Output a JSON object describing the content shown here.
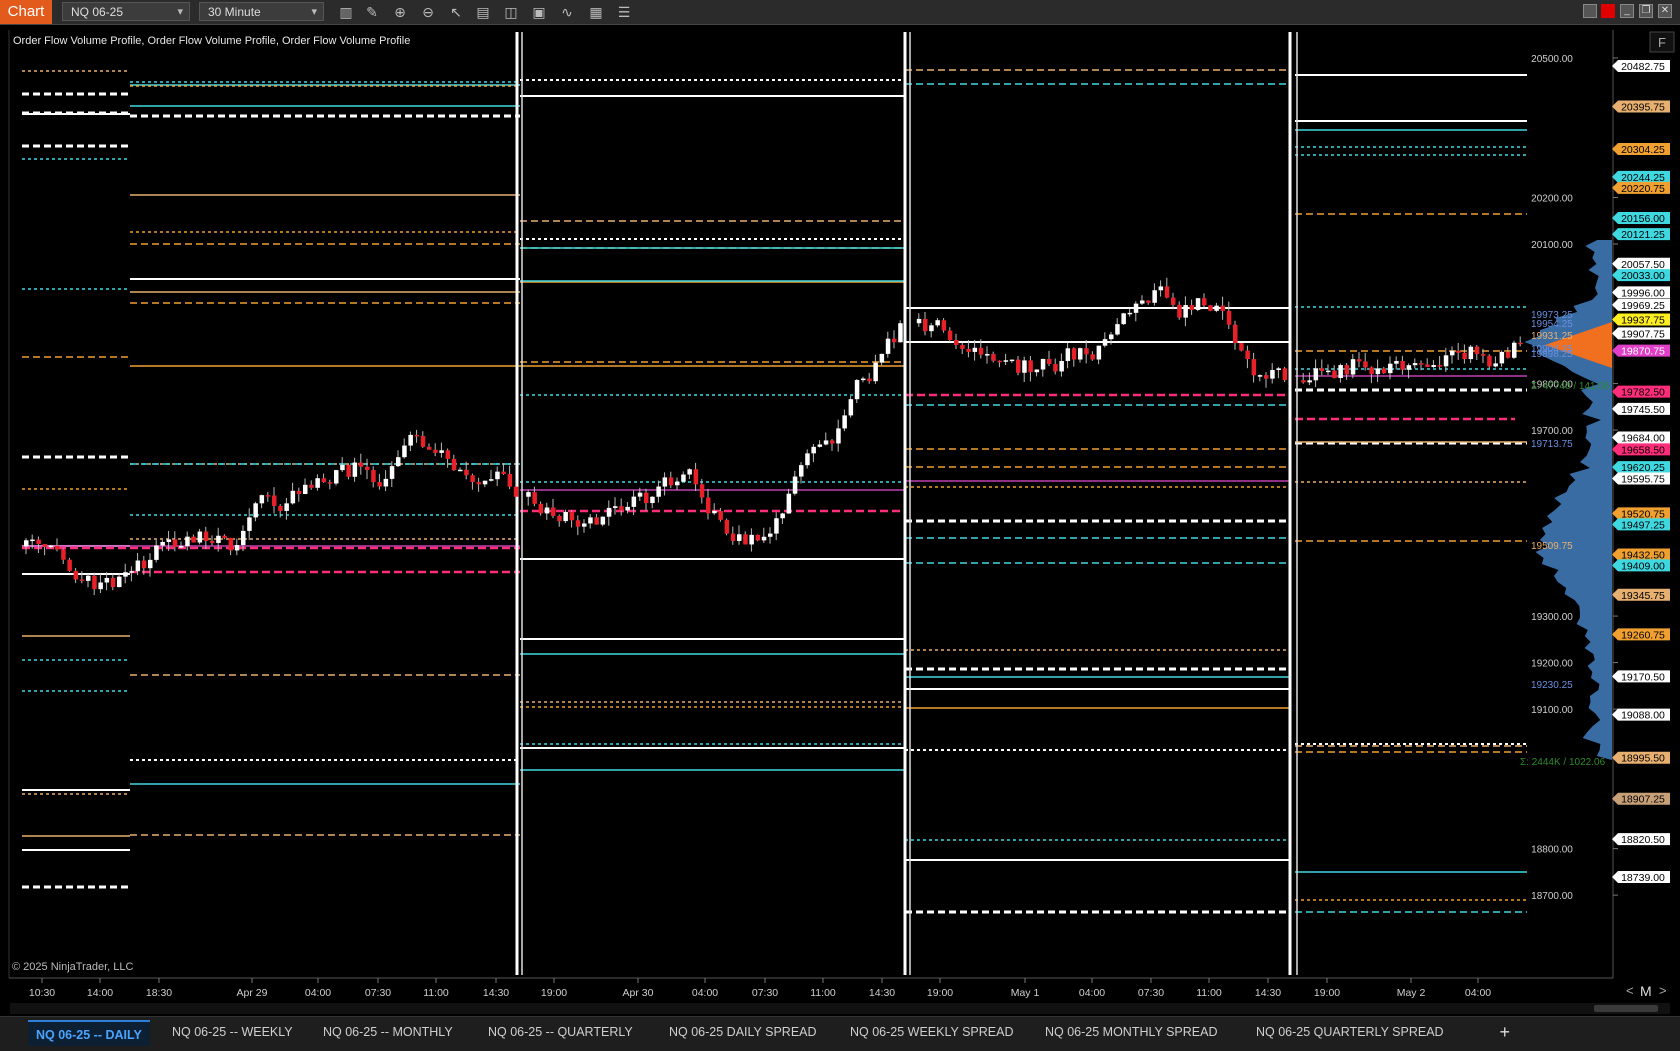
{
  "toolbar": {
    "chart_label": "Chart",
    "instrument": "NQ 06-25",
    "interval": "30 Minute",
    "tools": [
      "bar-style-icon",
      "draw-pencil-icon",
      "zoom-in-icon",
      "zoom-out-icon",
      "pointer-icon",
      "properties-icon",
      "split-panel-icon",
      "data-box-icon",
      "indicators-icon",
      "strategies-icon",
      "list-icon"
    ]
  },
  "chart": {
    "indicator_label": "Order Flow Volume Profile, Order Flow Volume Profile, Order Flow Volume Profile",
    "f_button": "F",
    "copyright": "© 2025 NinjaTrader, LLC",
    "y_axis_ticks": [
      "20500.00",
      "20200.00",
      "20100.00",
      "19800.00",
      "19700.00",
      "19300.00",
      "19200.00",
      "19100.00",
      "18800.00",
      "18700.00"
    ],
    "x_axis_labels": [
      "10:30",
      "14:00",
      "18:30",
      "Apr 29",
      "04:00",
      "07:30",
      "11:00",
      "14:30",
      "19:00",
      "Apr 30",
      "04:00",
      "07:30",
      "11:00",
      "14:30",
      "19:00",
      "May 1",
      "04:00",
      "07:30",
      "11:00",
      "14:30",
      "19:00",
      "May 2",
      "04:00"
    ],
    "price_markers": [
      {
        "text": "20482.75",
        "bg": "#ffffff",
        "fg": "#000000"
      },
      {
        "text": "20395.75",
        "bg": "#e8b070",
        "fg": "#000000"
      },
      {
        "text": "20304.25",
        "bg": "#f0a030",
        "fg": "#000000"
      },
      {
        "text": "20244.25",
        "bg": "#40d8e0",
        "fg": "#000000"
      },
      {
        "text": "20220.75",
        "bg": "#f0a030",
        "fg": "#000000"
      },
      {
        "text": "20156.00",
        "bg": "#40d8e0",
        "fg": "#000000"
      },
      {
        "text": "20121.25",
        "bg": "#40d8e0",
        "fg": "#000000"
      },
      {
        "text": "20057.50",
        "bg": "#ffffff",
        "fg": "#000000"
      },
      {
        "text": "20033.00",
        "bg": "#40d8e0",
        "fg": "#000000"
      },
      {
        "text": "19996.00",
        "bg": "#ffffff",
        "fg": "#000000"
      },
      {
        "text": "19969.25",
        "bg": "#ffffff",
        "fg": "#000000"
      },
      {
        "text": "19937.75",
        "bg": "#ffee22",
        "fg": "#000000"
      },
      {
        "text": "19907.75",
        "bg": "#ffffff",
        "fg": "#000000"
      },
      {
        "text": "19870.75",
        "bg": "#e040c8",
        "fg": "#ffffff"
      },
      {
        "text": "19782.50",
        "bg": "#ff2d7a",
        "fg": "#000000"
      },
      {
        "text": "19745.50",
        "bg": "#ffffff",
        "fg": "#000000"
      },
      {
        "text": "19684.00",
        "bg": "#ffffff",
        "fg": "#000000"
      },
      {
        "text": "19658.50",
        "bg": "#ff2d7a",
        "fg": "#000000"
      },
      {
        "text": "19620.25",
        "bg": "#40d8e0",
        "fg": "#000000"
      },
      {
        "text": "19595.75",
        "bg": "#ffffff",
        "fg": "#000000"
      },
      {
        "text": "19520.75",
        "bg": "#f0a030",
        "fg": "#000000"
      },
      {
        "text": "19497.25",
        "bg": "#40d8e0",
        "fg": "#000000"
      },
      {
        "text": "19432.50",
        "bg": "#f0a030",
        "fg": "#000000"
      },
      {
        "text": "19409.00",
        "bg": "#40d8e0",
        "fg": "#000000"
      },
      {
        "text": "19345.75",
        "bg": "#e8b070",
        "fg": "#000000"
      },
      {
        "text": "19260.75",
        "bg": "#f0a030",
        "fg": "#000000"
      },
      {
        "text": "19170.50",
        "bg": "#ffffff",
        "fg": "#000000"
      },
      {
        "text": "19088.00",
        "bg": "#ffffff",
        "fg": "#000000"
      },
      {
        "text": "18995.50",
        "bg": "#e8b070",
        "fg": "#000000"
      },
      {
        "text": "18907.25",
        "bg": "#c8a078",
        "fg": "#000000"
      },
      {
        "text": "18820.50",
        "bg": "#ffffff",
        "fg": "#000000"
      },
      {
        "text": "18739.00",
        "bg": "#ffffff",
        "fg": "#000000"
      }
    ],
    "profile_labels": [
      "19973.25",
      "19954.25",
      "19931.25",
      "19904.25",
      "19898.25",
      "Σ: 47740 / 141.06",
      "19713.75",
      "19509.75",
      "19230.25",
      "Σ: 2444K / 1022.06"
    ],
    "nav": {
      "left": "<",
      "m": "M",
      "right": ">"
    }
  },
  "tabs": {
    "items": [
      "NQ 06-25 -- DAILY",
      "NQ 06-25 -- WEEKLY",
      "NQ 06-25 -- MONTHLY",
      "NQ 06-25 -- QUARTERLY",
      "NQ 06-25 DAILY SPREAD",
      "NQ 06-25 WEEKLY SPREAD",
      "NQ 06-25 MONTHLY SPREAD",
      "NQ 06-25 QUARTERLY SPREAD"
    ],
    "add": "+"
  }
}
